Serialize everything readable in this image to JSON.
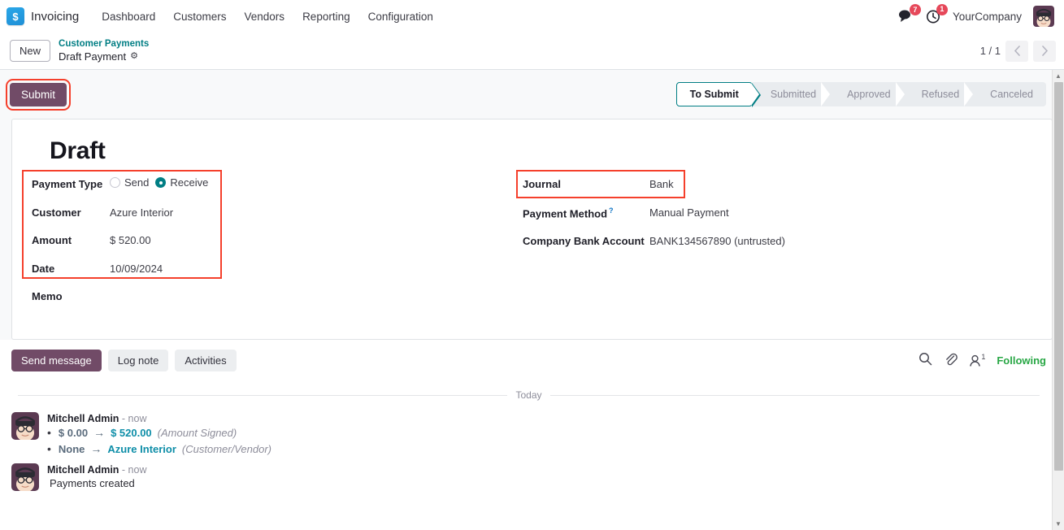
{
  "navbar": {
    "app_icon": "invoicing-dollar-icon",
    "app_name": "Invoicing",
    "menu_items": [
      {
        "label": "Dashboard"
      },
      {
        "label": "Customers"
      },
      {
        "label": "Vendors"
      },
      {
        "label": "Reporting"
      },
      {
        "label": "Configuration"
      }
    ],
    "messages_icon": "chat-bubble-icon",
    "messages_badge": "7",
    "activities_icon": "clock-icon",
    "activities_badge": "1",
    "company": "YourCompany",
    "avatar_icon": "user-avatar"
  },
  "breadcrumb": {
    "new_label": "New",
    "parent": "Customer Payments",
    "current": "Draft Payment",
    "gear_icon": "gear-icon",
    "pager_count": "1 / 1",
    "prev_icon": "chevron-left-icon",
    "next_icon": "chevron-right-icon"
  },
  "control_panel": {
    "submit_label": "Submit",
    "statusbar": [
      {
        "label": "To Submit",
        "active": true
      },
      {
        "label": "Submitted",
        "active": false
      },
      {
        "label": "Approved",
        "active": false
      },
      {
        "label": "Refused",
        "active": false
      },
      {
        "label": "Canceled",
        "active": false
      }
    ]
  },
  "form": {
    "title": "Draft",
    "left": {
      "payment_type_label": "Payment Type",
      "payment_type_options": [
        {
          "label": "Send",
          "selected": false
        },
        {
          "label": "Receive",
          "selected": true
        }
      ],
      "customer_label": "Customer",
      "customer_value": "Azure Interior",
      "amount_label": "Amount",
      "amount_value": "$ 520.00",
      "date_label": "Date",
      "date_value": "10/09/2024",
      "memo_label": "Memo",
      "memo_value": ""
    },
    "right": {
      "journal_label": "Journal",
      "journal_value": "Bank",
      "payment_method_label": "Payment Method",
      "payment_method_help": "?",
      "payment_method_value": "Manual Payment",
      "company_bank_label": "Company Bank Account",
      "company_bank_value": "BANK134567890 (untrusted)"
    }
  },
  "chatter": {
    "send_message_label": "Send message",
    "log_note_label": "Log note",
    "activities_label": "Activities",
    "search_icon": "search-icon",
    "attachment_icon": "paperclip-icon",
    "followers_icon": "user-icon",
    "followers_count": "1",
    "following_label": "Following",
    "date_separator": "Today",
    "messages": [
      {
        "author": "Mitchell Admin",
        "time": "- now",
        "avatar_icon": "user-avatar",
        "tracking": [
          {
            "old": "$ 0.00",
            "arrow": "→",
            "new": "$ 520.00",
            "field": "(Amount Signed)"
          },
          {
            "old": "None",
            "arrow": "→",
            "new": "Azure Interior",
            "field": "(Customer/Vendor)"
          }
        ],
        "text": ""
      },
      {
        "author": "Mitchell Admin",
        "time": "- now",
        "avatar_icon": "user-avatar",
        "tracking": [],
        "text": "Payments created"
      }
    ]
  },
  "scrollbar": {
    "up_icon": "triangle-up-icon",
    "down_icon": "triangle-down-icon"
  },
  "colors": {
    "accent_purple": "#714b67",
    "accent_teal": "#017e84",
    "highlight_red": "#f5402c",
    "link_teal": "#0e8ea8",
    "following_green": "#28a745",
    "badge_red": "#e6485a"
  }
}
